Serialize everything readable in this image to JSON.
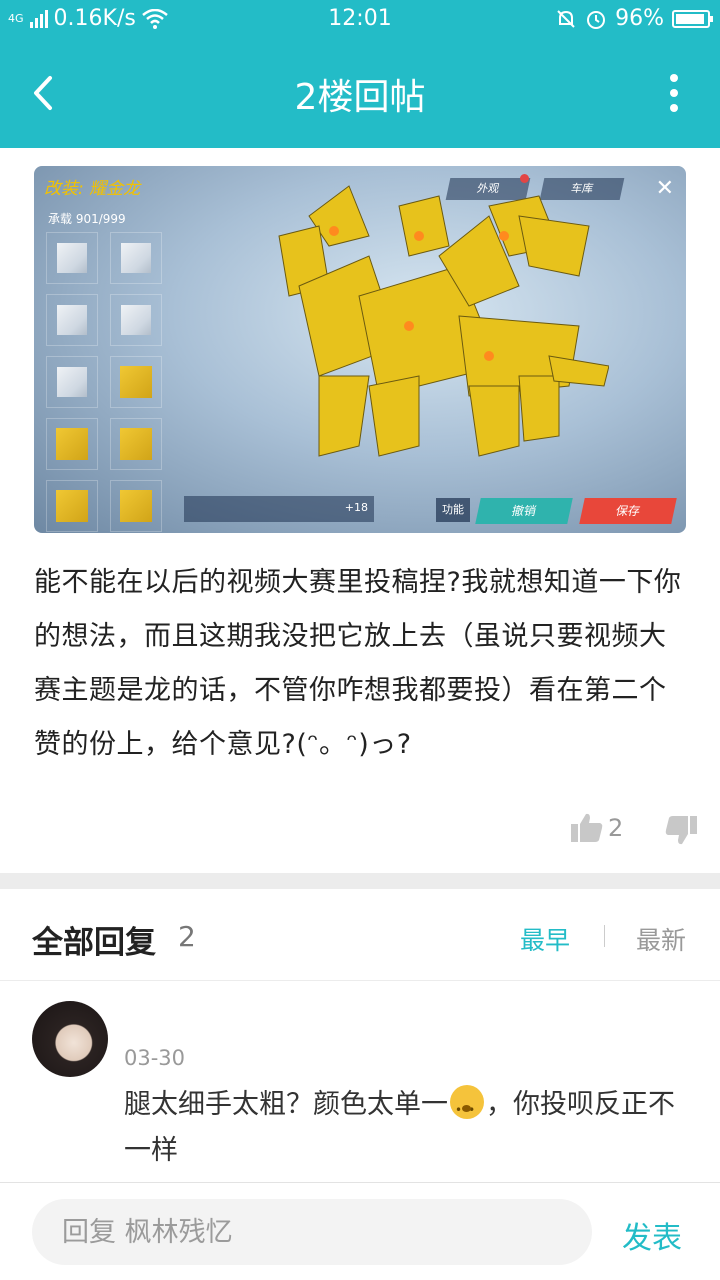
{
  "status_bar": {
    "network": "4G",
    "speed": "0.16K/s",
    "time": "12:01",
    "battery": "96%"
  },
  "app_bar": {
    "title": "2楼回帖",
    "back_icon": "chevron-left-icon",
    "more_icon": "more-vertical-icon"
  },
  "screenshot": {
    "title": "改装: 耀金龙",
    "load": "承载 901/999",
    "btn_appearance": "外观",
    "btn_garage": "车库",
    "toolbar_extra": "+18",
    "btn_function": "功能",
    "btn_undo": "撤销",
    "btn_save": "保存"
  },
  "post": {
    "text": "能不能在以后的视频大赛里投稿捏?我就想知道一下你的想法，而且这期我没把它放上去（虽说只要视频大赛主题是龙的话，不管你咋想我都要投）看在第二个赞的份上，给个意见?(ᵔ。ᵔ)っ?",
    "likes": "2"
  },
  "replies": {
    "label": "全部回复",
    "count": "2",
    "sort_earliest": "最早",
    "sort_newest": "最新"
  },
  "comment": {
    "date": "03-30",
    "text_before": "腿太细手太粗？颜色太单一",
    "text_after": "，你投呗反正不一样"
  },
  "reply_bar": {
    "placeholder": "回复 枫林残忆",
    "publish": "发表"
  },
  "colors": {
    "accent": "#23bcc7",
    "dragon_yellow": "#e7c21c"
  }
}
